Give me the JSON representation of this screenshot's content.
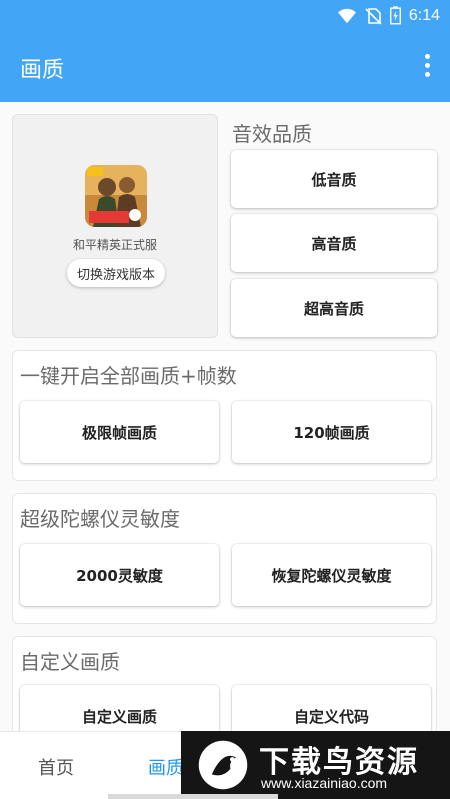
{
  "status_bar": {
    "time": "6:14"
  },
  "app_bar": {
    "title": "画质"
  },
  "game": {
    "name": "和平精英正式服",
    "switch_label": "切换游戏版本"
  },
  "sound_quality": {
    "title": "音效品质",
    "buttons": [
      "低音质",
      "高音质",
      "超高音质"
    ]
  },
  "one_click": {
    "title": "一键开启全部画质+帧数",
    "buttons": [
      "极限帧画质",
      "120帧画质"
    ]
  },
  "gyro": {
    "title": "超级陀螺仪灵敏度",
    "buttons": [
      "2000灵敏度",
      "恢复陀螺仪灵敏度"
    ]
  },
  "custom": {
    "title": "自定义画质",
    "buttons": [
      "自定义画质",
      "自定义代码"
    ]
  },
  "bottom_nav": {
    "items": [
      "首页",
      "画质"
    ],
    "active": 1
  },
  "watermark": {
    "brand": "下载鸟资源",
    "url": "www.xiazainiao.com"
  },
  "colors": {
    "primary": "#42a5f5",
    "accent": "#2196f3"
  }
}
